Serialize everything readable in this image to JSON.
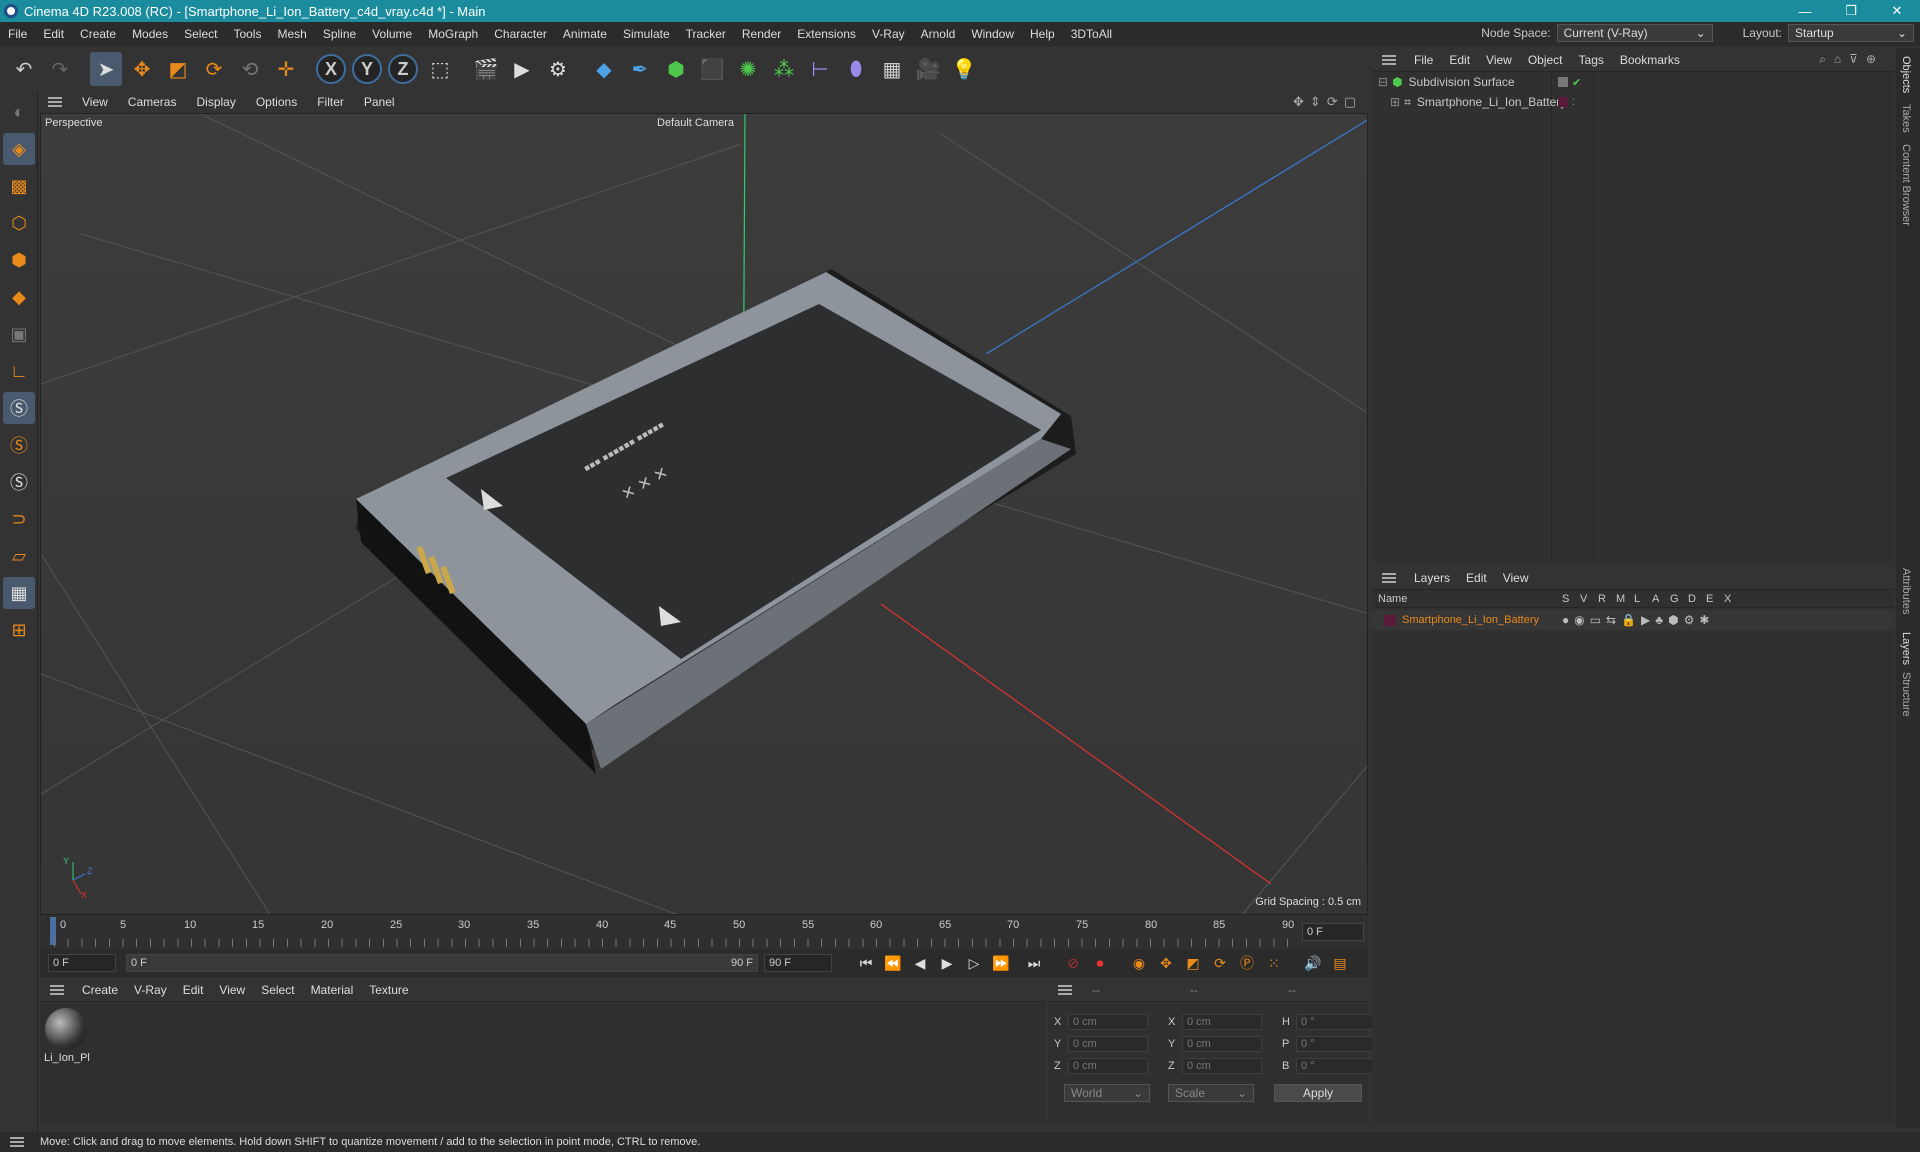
{
  "window": {
    "title": "Cinema 4D R23.008 (RC) - [Smartphone_Li_Ion_Battery_c4d_vray.c4d *] - Main",
    "minimize": "—",
    "restore": "❐",
    "close": "✕"
  },
  "menu": [
    "File",
    "Edit",
    "Create",
    "Modes",
    "Select",
    "Tools",
    "Mesh",
    "Spline",
    "Volume",
    "MoGraph",
    "Character",
    "Animate",
    "Simulate",
    "Tracker",
    "Render",
    "Extensions",
    "V-Ray",
    "Arnold",
    "Window",
    "Help",
    "3DToAll"
  ],
  "node_space": {
    "label": "Node Space:",
    "value": "Current (V-Ray)"
  },
  "layout": {
    "label": "Layout:",
    "value": "Startup"
  },
  "axis_buttons": [
    "X",
    "Y",
    "Z"
  ],
  "viewport": {
    "menu": [
      "View",
      "Cameras",
      "Display",
      "Options",
      "Filter",
      "Panel"
    ],
    "view_name": "Perspective",
    "camera": "Default Camera",
    "grid_spacing": "Grid Spacing : 0.5 cm",
    "axis_x": "X",
    "axis_y": "Y",
    "axis_z": "Z"
  },
  "timeline": {
    "ticks": [
      "0",
      "5",
      "10",
      "15",
      "20",
      "25",
      "30",
      "35",
      "40",
      "45",
      "50",
      "55",
      "60",
      "65",
      "70",
      "75",
      "80",
      "85",
      "90"
    ],
    "current_frame": "0 F"
  },
  "transport": {
    "start": "0 F",
    "range_start": "0 F",
    "range_end": "90 F",
    "end": "90 F"
  },
  "material_panel": {
    "menu": [
      "Create",
      "V-Ray",
      "Edit",
      "View",
      "Select",
      "Material",
      "Texture"
    ],
    "material_name": "Li_Ion_Pl"
  },
  "coords": {
    "headers": [
      "--",
      "--",
      "--"
    ],
    "rows": [
      {
        "a": "X",
        "av": "0 cm",
        "b": "X",
        "bv": "0 cm",
        "c": "H",
        "cv": "0 °"
      },
      {
        "a": "Y",
        "av": "0 cm",
        "b": "Y",
        "bv": "0 cm",
        "c": "P",
        "cv": "0 °"
      },
      {
        "a": "Z",
        "av": "0 cm",
        "b": "Z",
        "bv": "0 cm",
        "c": "B",
        "cv": "0 °"
      }
    ],
    "world": "World",
    "scale": "Scale",
    "apply": "Apply"
  },
  "objects_panel": {
    "menu": [
      "File",
      "Edit",
      "View",
      "Object",
      "Tags",
      "Bookmarks"
    ],
    "items": [
      "Subdivision Surface",
      "Smartphone_Li_Ion_Battery"
    ]
  },
  "layers_panel": {
    "menu": [
      "Layers",
      "Edit",
      "View"
    ],
    "columns_name": "Name",
    "columns": [
      "S",
      "V",
      "R",
      "M",
      "L",
      "A",
      "G",
      "D",
      "E",
      "X"
    ],
    "layer": "Smartphone_Li_Ion_Battery"
  },
  "side_tabs": [
    "Objects",
    "Takes",
    "Content Browser",
    "Attributes",
    "Layers",
    "Structure"
  ],
  "status": "Move: Click and drag to move elements. Hold down SHIFT to quantize movement / add to the selection in point mode, CTRL to remove.",
  "colors": {
    "titlebar": "#1a8c9e",
    "accent": "#e88a1a",
    "layer_color": "#5a1a3a"
  }
}
